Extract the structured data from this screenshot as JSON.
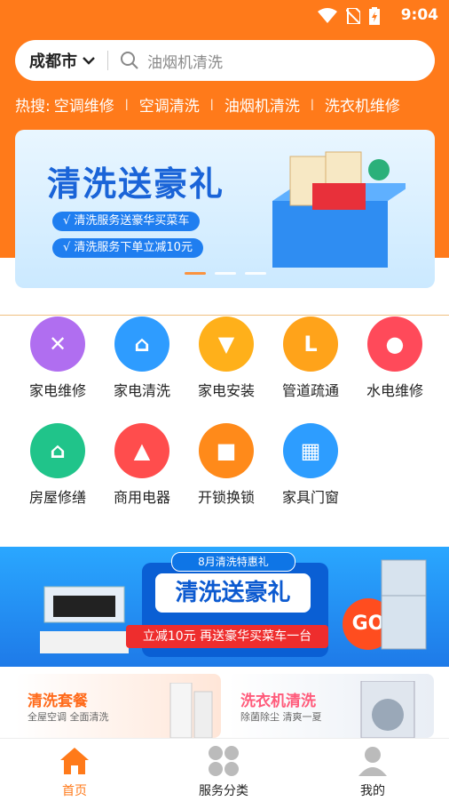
{
  "status": {
    "time": "9:04"
  },
  "header": {
    "city": "成都市",
    "search_placeholder": "油烟机清洗",
    "hot_label": "热搜:",
    "hot_items": [
      "空调维修",
      "空调清洗",
      "油烟机清洗",
      "洗衣机维修"
    ]
  },
  "banner": {
    "title": "清洗送豪礼",
    "lines": [
      "√ 清洗服务送豪华买菜车",
      "√ 清洗服务下单立减10元"
    ]
  },
  "categories": [
    {
      "label": "家电维修",
      "color": "#b06ef0"
    },
    {
      "label": "家电清洗",
      "color": "#2e9cff"
    },
    {
      "label": "家电安装",
      "color": "#ffb01a"
    },
    {
      "label": "管道疏通",
      "color": "#ffa31a"
    },
    {
      "label": "水电维修",
      "color": "#ff4a5a"
    },
    {
      "label": "房屋修缮",
      "color": "#20c48a"
    },
    {
      "label": "商用电器",
      "color": "#ff4d4d"
    },
    {
      "label": "开锁换锁",
      "color": "#ff8a1a"
    },
    {
      "label": "家具门窗",
      "color": "#2d9dff"
    }
  ],
  "promo": {
    "tag": "8月清洗特惠礼",
    "title": "清洗送豪礼",
    "subtitle": "立减10元 再送豪华买菜车一台",
    "go": "GO"
  },
  "cards": [
    {
      "title": "清洗套餐",
      "subtitle": "全屋空调 全面清洗",
      "color": "#ff6a1a"
    },
    {
      "title": "洗衣机清洗",
      "subtitle": "除菌除尘 清爽一夏",
      "color": "#ff5a7a"
    }
  ],
  "tabs": [
    {
      "label": "首页",
      "icon": "home-icon",
      "active": true
    },
    {
      "label": "服务分类",
      "icon": "grid-icon",
      "active": false
    },
    {
      "label": "我的",
      "icon": "user-icon",
      "active": false
    }
  ],
  "colors": {
    "brand": "#ff7a1a",
    "active_tab": "#ff7a1a",
    "inactive_tab": "#222222"
  }
}
